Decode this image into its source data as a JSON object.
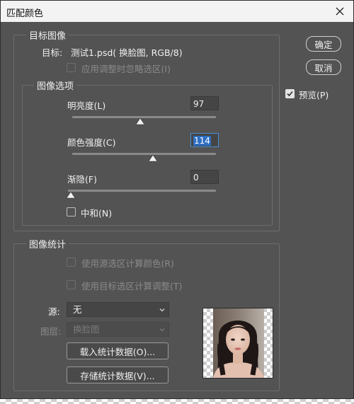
{
  "window": {
    "title": "匹配颜色"
  },
  "target_image": {
    "legend": "目标图像",
    "target_label": "目标:",
    "target_value": "测试1.psd( 换脸图, RGB/8)",
    "ignore_selection_label": "应用调整时忽略选区(I)"
  },
  "image_options": {
    "legend": "图像选项",
    "luminance": {
      "label": "明亮度(L)",
      "value": "97",
      "level": 97,
      "min": 1,
      "max": 200
    },
    "color_intensity": {
      "label": "颜色强度(C)",
      "value": "114",
      "level": 114,
      "min": 1,
      "max": 200
    },
    "fade": {
      "label": "渐隐(F)",
      "value": "0",
      "level": 0,
      "min": 0,
      "max": 100
    },
    "neutralize": {
      "label": "中和(N)",
      "checked": false
    }
  },
  "image_statistics": {
    "legend": "图像统计",
    "use_source_selection_label": "使用源选区计算颜色(R)",
    "use_target_selection_label": "使用目标选区计算调整(T)",
    "source_label": "源:",
    "source_value": "无",
    "layer_label": "图层:",
    "layer_value": "换脸图",
    "load_button": "载入统计数据(O)...",
    "save_button": "存储统计数据(V)..."
  },
  "buttons": {
    "ok": "确定",
    "cancel": "取消"
  },
  "preview": {
    "label": "预览(P)",
    "checked": true
  },
  "colors": {
    "panel": "#535353",
    "accent": "#2f6fc2",
    "titlebar": "#f3f3f3"
  }
}
